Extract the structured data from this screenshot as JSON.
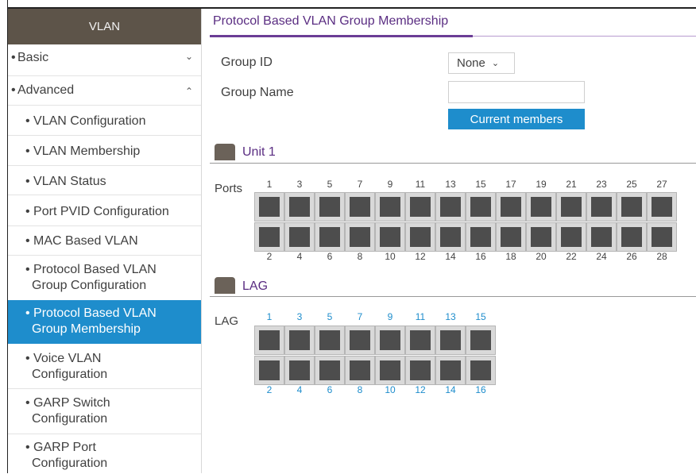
{
  "sidebar": {
    "header": "VLAN",
    "basic": "Basic",
    "advanced": "Advanced",
    "items": [
      {
        "line1": "VLAN Configuration",
        "line2": ""
      },
      {
        "line1": "VLAN Membership",
        "line2": ""
      },
      {
        "line1": "VLAN Status",
        "line2": ""
      },
      {
        "line1": "Port PVID Configuration",
        "line2": ""
      },
      {
        "line1": "MAC Based VLAN",
        "line2": ""
      },
      {
        "line1": "Protocol Based VLAN",
        "line2": "Group Configuration"
      },
      {
        "line1": "Protocol Based VLAN",
        "line2": "Group Membership"
      },
      {
        "line1": "Voice VLAN",
        "line2": "Configuration"
      },
      {
        "line1": "GARP Switch",
        "line2": "Configuration"
      },
      {
        "line1": "GARP Port",
        "line2": "Configuration"
      }
    ],
    "active_index": 6
  },
  "main": {
    "title": "Protocol Based VLAN Group Membership",
    "group_id_label": "Group ID",
    "group_id_value": "None",
    "group_name_label": "Group Name",
    "group_name_value": "",
    "current_members_label": "Current members"
  },
  "unit": {
    "title": "Unit 1",
    "row_label": "Ports",
    "top_numbers": [
      "1",
      "3",
      "5",
      "7",
      "9",
      "11",
      "13",
      "15",
      "17",
      "19",
      "21",
      "23",
      "25",
      "27"
    ],
    "bottom_numbers": [
      "2",
      "4",
      "6",
      "8",
      "10",
      "12",
      "14",
      "16",
      "18",
      "20",
      "22",
      "24",
      "26",
      "28"
    ]
  },
  "lag": {
    "title": "LAG",
    "row_label": "LAG",
    "top_numbers": [
      "1",
      "3",
      "5",
      "7",
      "9",
      "11",
      "13",
      "15"
    ],
    "bottom_numbers": [
      "2",
      "4",
      "6",
      "8",
      "10",
      "12",
      "14",
      "16"
    ]
  },
  "colors": {
    "accent_blue": "#1e8dcc",
    "title_purple": "#5a2d82",
    "header_brown": "#5d5449"
  }
}
